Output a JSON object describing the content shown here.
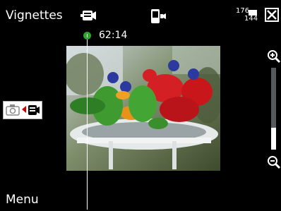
{
  "header": {
    "title": "Vignettes"
  },
  "recording": {
    "elapsed": "62:14"
  },
  "softkeys": {
    "left": "Menu"
  },
  "resolution": {
    "top": "176",
    "bottom": "144"
  },
  "icons": {
    "video_camera": "video-camera-icon",
    "phone_video": "phone-video-icon",
    "close": "close-icon",
    "zoom_in": "zoom-in-icon",
    "zoom_out": "zoom-out-icon",
    "photo_mode": "camera-icon"
  },
  "zoom": {
    "level": 0.27
  },
  "colors": {
    "record": "#2fa52f",
    "background": "#000000"
  }
}
